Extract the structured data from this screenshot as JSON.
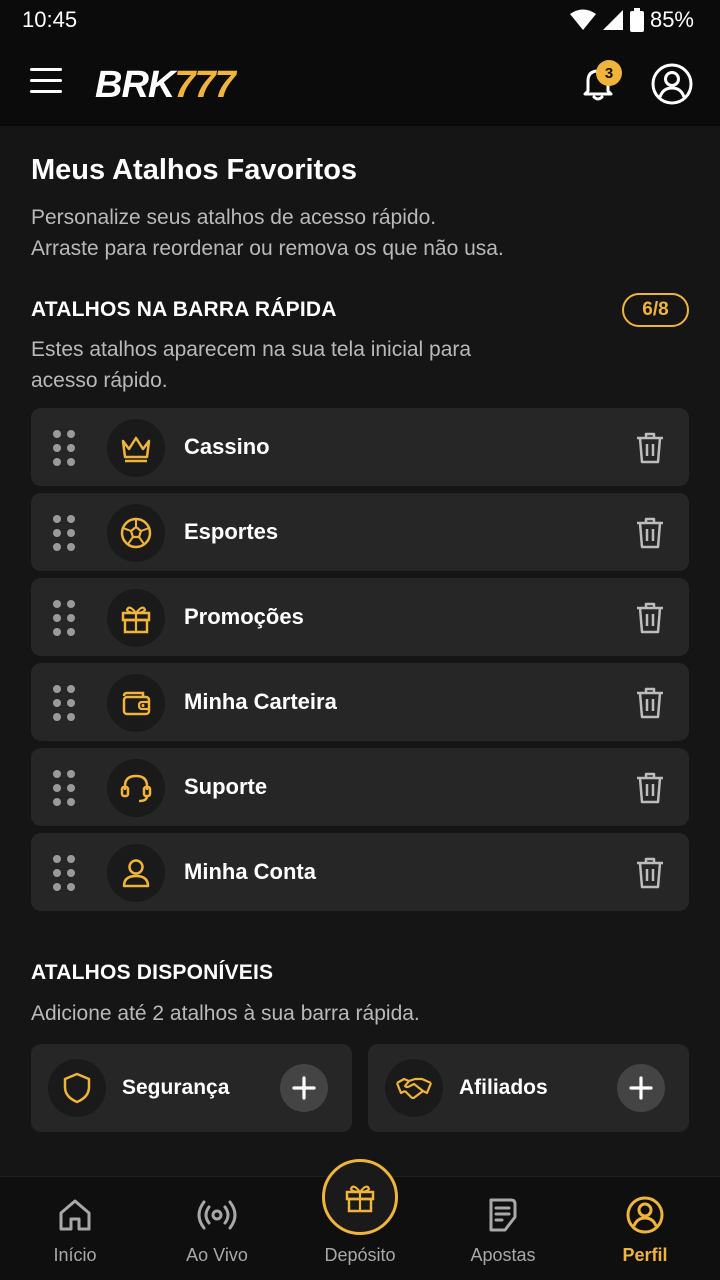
{
  "status_bar": {
    "time": "10:45",
    "battery": "85%"
  },
  "app_bar": {
    "logo_part1": "BRK",
    "logo_part2": "777",
    "notification_count": "3"
  },
  "page": {
    "title": "Meus Atalhos Favoritos",
    "subtitle_line1": "Personalize seus atalhos de acesso rápido.",
    "subtitle_line2": "Arraste para reordenar ou remova os que não usa."
  },
  "quick_bar": {
    "heading": "ATALHOS NA BARRA RÁPIDA",
    "counter": "6/8",
    "description_line1": "Estes atalhos aparecem na sua tela inicial para",
    "description_line2": "acesso rápido.",
    "items": [
      {
        "label": "Cassino",
        "icon": "crown-icon"
      },
      {
        "label": "Esportes",
        "icon": "soccer-ball-icon"
      },
      {
        "label": "Promoções",
        "icon": "gift-icon"
      },
      {
        "label": "Minha Carteira",
        "icon": "wallet-icon"
      },
      {
        "label": "Suporte",
        "icon": "headset-icon"
      },
      {
        "label": "Minha Conta",
        "icon": "user-icon"
      }
    ]
  },
  "available": {
    "heading": "ATALHOS DISPONÍVEIS",
    "description": "Adicione até 2 atalhos à sua barra rápida.",
    "items": [
      {
        "label": "Segurança",
        "icon": "shield-icon"
      },
      {
        "label": "Afiliados",
        "icon": "handshake-icon"
      }
    ]
  },
  "bottom_nav": {
    "items": [
      {
        "label": "Início",
        "icon": "home-icon"
      },
      {
        "label": "Ao Vivo",
        "icon": "live-broadcast-icon"
      },
      {
        "label": "Depósito",
        "icon": "gift-icon"
      },
      {
        "label": "Apostas",
        "icon": "betslip-icon"
      },
      {
        "label": "Perfil",
        "icon": "profile-icon"
      }
    ],
    "active": "Perfil"
  },
  "colors": {
    "accent": "#f0b43c",
    "background": "#151515",
    "card": "#262626"
  }
}
